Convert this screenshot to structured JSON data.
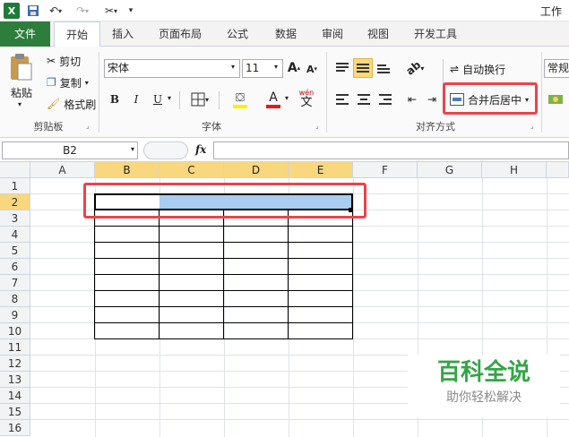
{
  "app": {
    "title": "工作"
  },
  "tabs": [
    "文件",
    "开始",
    "插入",
    "页面布局",
    "公式",
    "数据",
    "审阅",
    "视图",
    "开发工具"
  ],
  "clipboard": {
    "paste": "粘贴",
    "cut": "剪切",
    "copy": "复制",
    "format_painter": "格式刷",
    "label": "剪贴板"
  },
  "font": {
    "name": "宋体",
    "size": "11",
    "bold": "B",
    "italic": "I",
    "underline": "U",
    "label": "字体",
    "grow": "A",
    "shrink": "A",
    "wen": "wén",
    "wen_char": "文"
  },
  "alignment": {
    "wrap_text": "自动换行",
    "merge_center": "合并后居中",
    "label": "对齐方式"
  },
  "number": {
    "format": "常规"
  },
  "formula_bar": {
    "name_box": "B2",
    "fx": "fx"
  },
  "columns": [
    "A",
    "B",
    "C",
    "D",
    "E",
    "F",
    "G",
    "H"
  ],
  "rows": [
    "1",
    "2",
    "3",
    "4",
    "5",
    "6",
    "7",
    "8",
    "9",
    "10",
    "11",
    "12",
    "13",
    "14",
    "15",
    "16"
  ],
  "watermark": {
    "title": "百科全说",
    "subtitle": "助你轻松解决"
  },
  "colors": {
    "file_tab": "#2d7d3d",
    "selected_header": "#f9d77e",
    "selection_fill": "#a8cdf1",
    "highlight_border": "#e8454b",
    "watermark_title": "#35a548"
  }
}
